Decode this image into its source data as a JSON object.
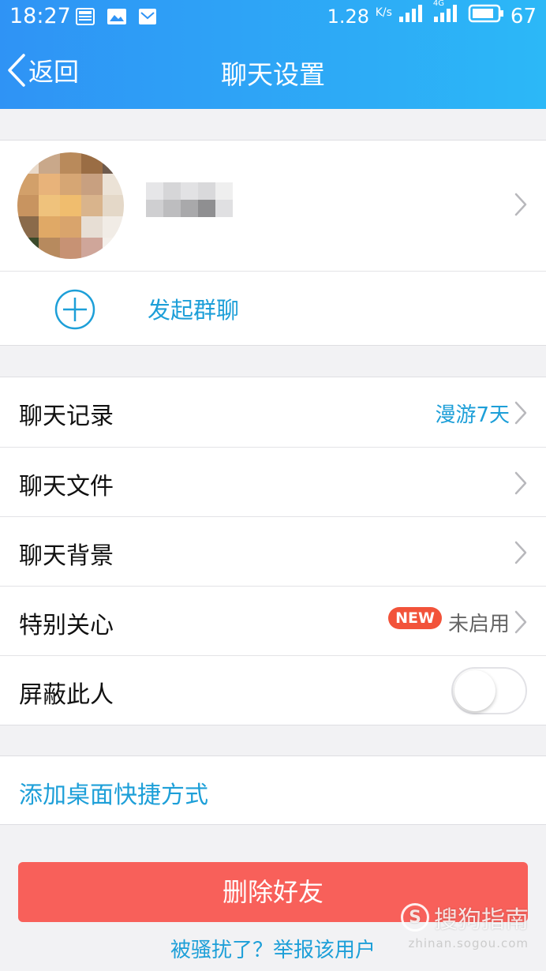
{
  "status_bar": {
    "time": "18:27",
    "speed": "1.28",
    "speed_unit": "K/s",
    "network": "4G",
    "battery": "67",
    "icons": [
      "news-icon",
      "image-icon",
      "mail-icon",
      "signal-icon",
      "battery-icon"
    ]
  },
  "nav": {
    "back_label": "返回",
    "title": "聊天设置"
  },
  "profile": {
    "name": ""
  },
  "group": {
    "label": "发起群聊"
  },
  "settings": [
    {
      "label": "聊天记录",
      "value": "漫游7天",
      "value_color": "#1d9fd8"
    },
    {
      "label": "聊天文件",
      "value": ""
    },
    {
      "label": "聊天背景",
      "value": ""
    },
    {
      "label": "特别关心",
      "badge": "NEW",
      "value": "未启用",
      "value_color": "#666666"
    },
    {
      "label": "屏蔽此人",
      "toggle": false
    }
  ],
  "shortcut": {
    "label": "添加桌面快捷方式"
  },
  "actions": {
    "delete_label": "删除好友",
    "report_label": "被骚扰了？举报该用户"
  },
  "watermark": {
    "text": "搜狗指南",
    "sub": "zhinan.sogou.com"
  },
  "colors": {
    "header_start": "#2f93f5",
    "header_end": "#2cb8f7",
    "accent": "#1d9fd8",
    "danger": "#f8605a",
    "badge": "#f2533a"
  }
}
